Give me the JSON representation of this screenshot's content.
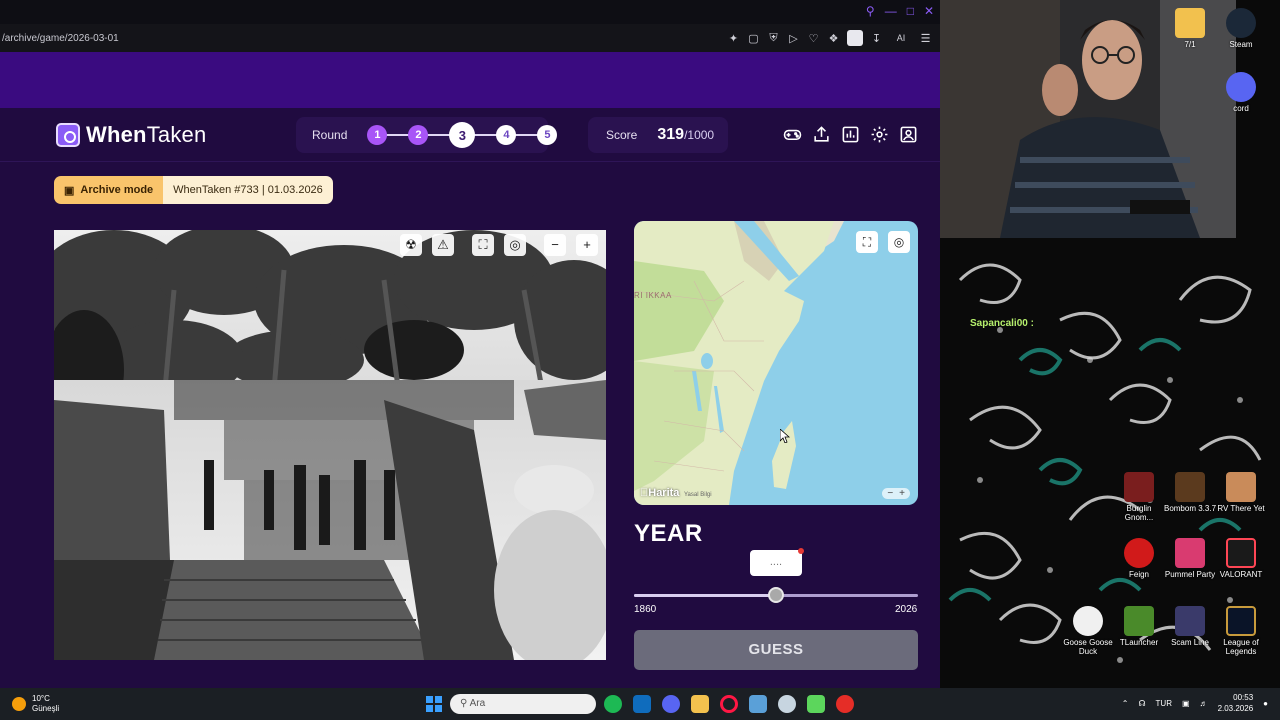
{
  "browser": {
    "url": "/archive/game/2026-03-01",
    "ai_label": "AI"
  },
  "app": {
    "logo_bold": "When",
    "logo_light": "Taken",
    "round_label": "Round",
    "rounds": [
      "1",
      "2",
      "3",
      "4",
      "5"
    ],
    "current_round": 3,
    "score_label": "Score",
    "score_value": "319",
    "score_max": "/1000",
    "archive_mode_label": "Archive mode",
    "archive_info": "WhenTaken #733 | 01.03.2026",
    "map_region_label": "RI IKKAA",
    "map_brand": "Harita",
    "map_legal": "Yasal Bilgi",
    "year_title": "YEAR",
    "year_input_value": "....",
    "slider_min": "1860",
    "slider_max": "2026",
    "slider_value_fraction": 0.5,
    "guess_label": "GUESS",
    "accent_color": "#8b5cf6"
  },
  "desktop": {
    "chat_user": "Sapancali00 :",
    "chat_msg": "",
    "icons": [
      {
        "label": "7/1",
        "color": "#f2c14e",
        "icon": "folder-icon"
      },
      {
        "label": "Steam",
        "color": "#1b2838",
        "icon": "steam-icon"
      },
      {
        "label": "cord",
        "color": "#5865f2",
        "icon": "discord-icon"
      },
      {
        "label": "Burglin Gnom...",
        "color": "#7a1e1e",
        "icon": "burglin-gnomes-icon"
      },
      {
        "label": "Bombom 3.3.7",
        "color": "#5b3a1e",
        "icon": "bombom-icon"
      },
      {
        "label": "RV There Yet",
        "color": "#c98b5a",
        "icon": "rv-there-yet-icon"
      },
      {
        "label": "Feign",
        "color": "#d11a1a",
        "icon": "feign-icon"
      },
      {
        "label": "Pummel Party",
        "color": "#d93b70",
        "icon": "pummel-party-icon"
      },
      {
        "label": "VALORANT",
        "color": "#1a1a1a",
        "icon": "valorant-icon"
      },
      {
        "label": "Goose Goose Duck",
        "color": "#f0f0f0",
        "icon": "goose-goose-duck-icon"
      },
      {
        "label": "TLauncher",
        "color": "#4a8a2a",
        "icon": "tlauncher-icon"
      },
      {
        "label": "Scam Line",
        "color": "#3a3a6a",
        "icon": "scam-line-icon"
      },
      {
        "label": "League of Legends",
        "color": "#c89b3c",
        "icon": "league-of-legends-icon"
      }
    ]
  },
  "taskbar": {
    "weather_temp": "10°C",
    "weather_desc": "Güneşli",
    "search_placeholder": "Ara",
    "lang": "TUR",
    "time": "00:53",
    "date": "2.03.2026"
  }
}
